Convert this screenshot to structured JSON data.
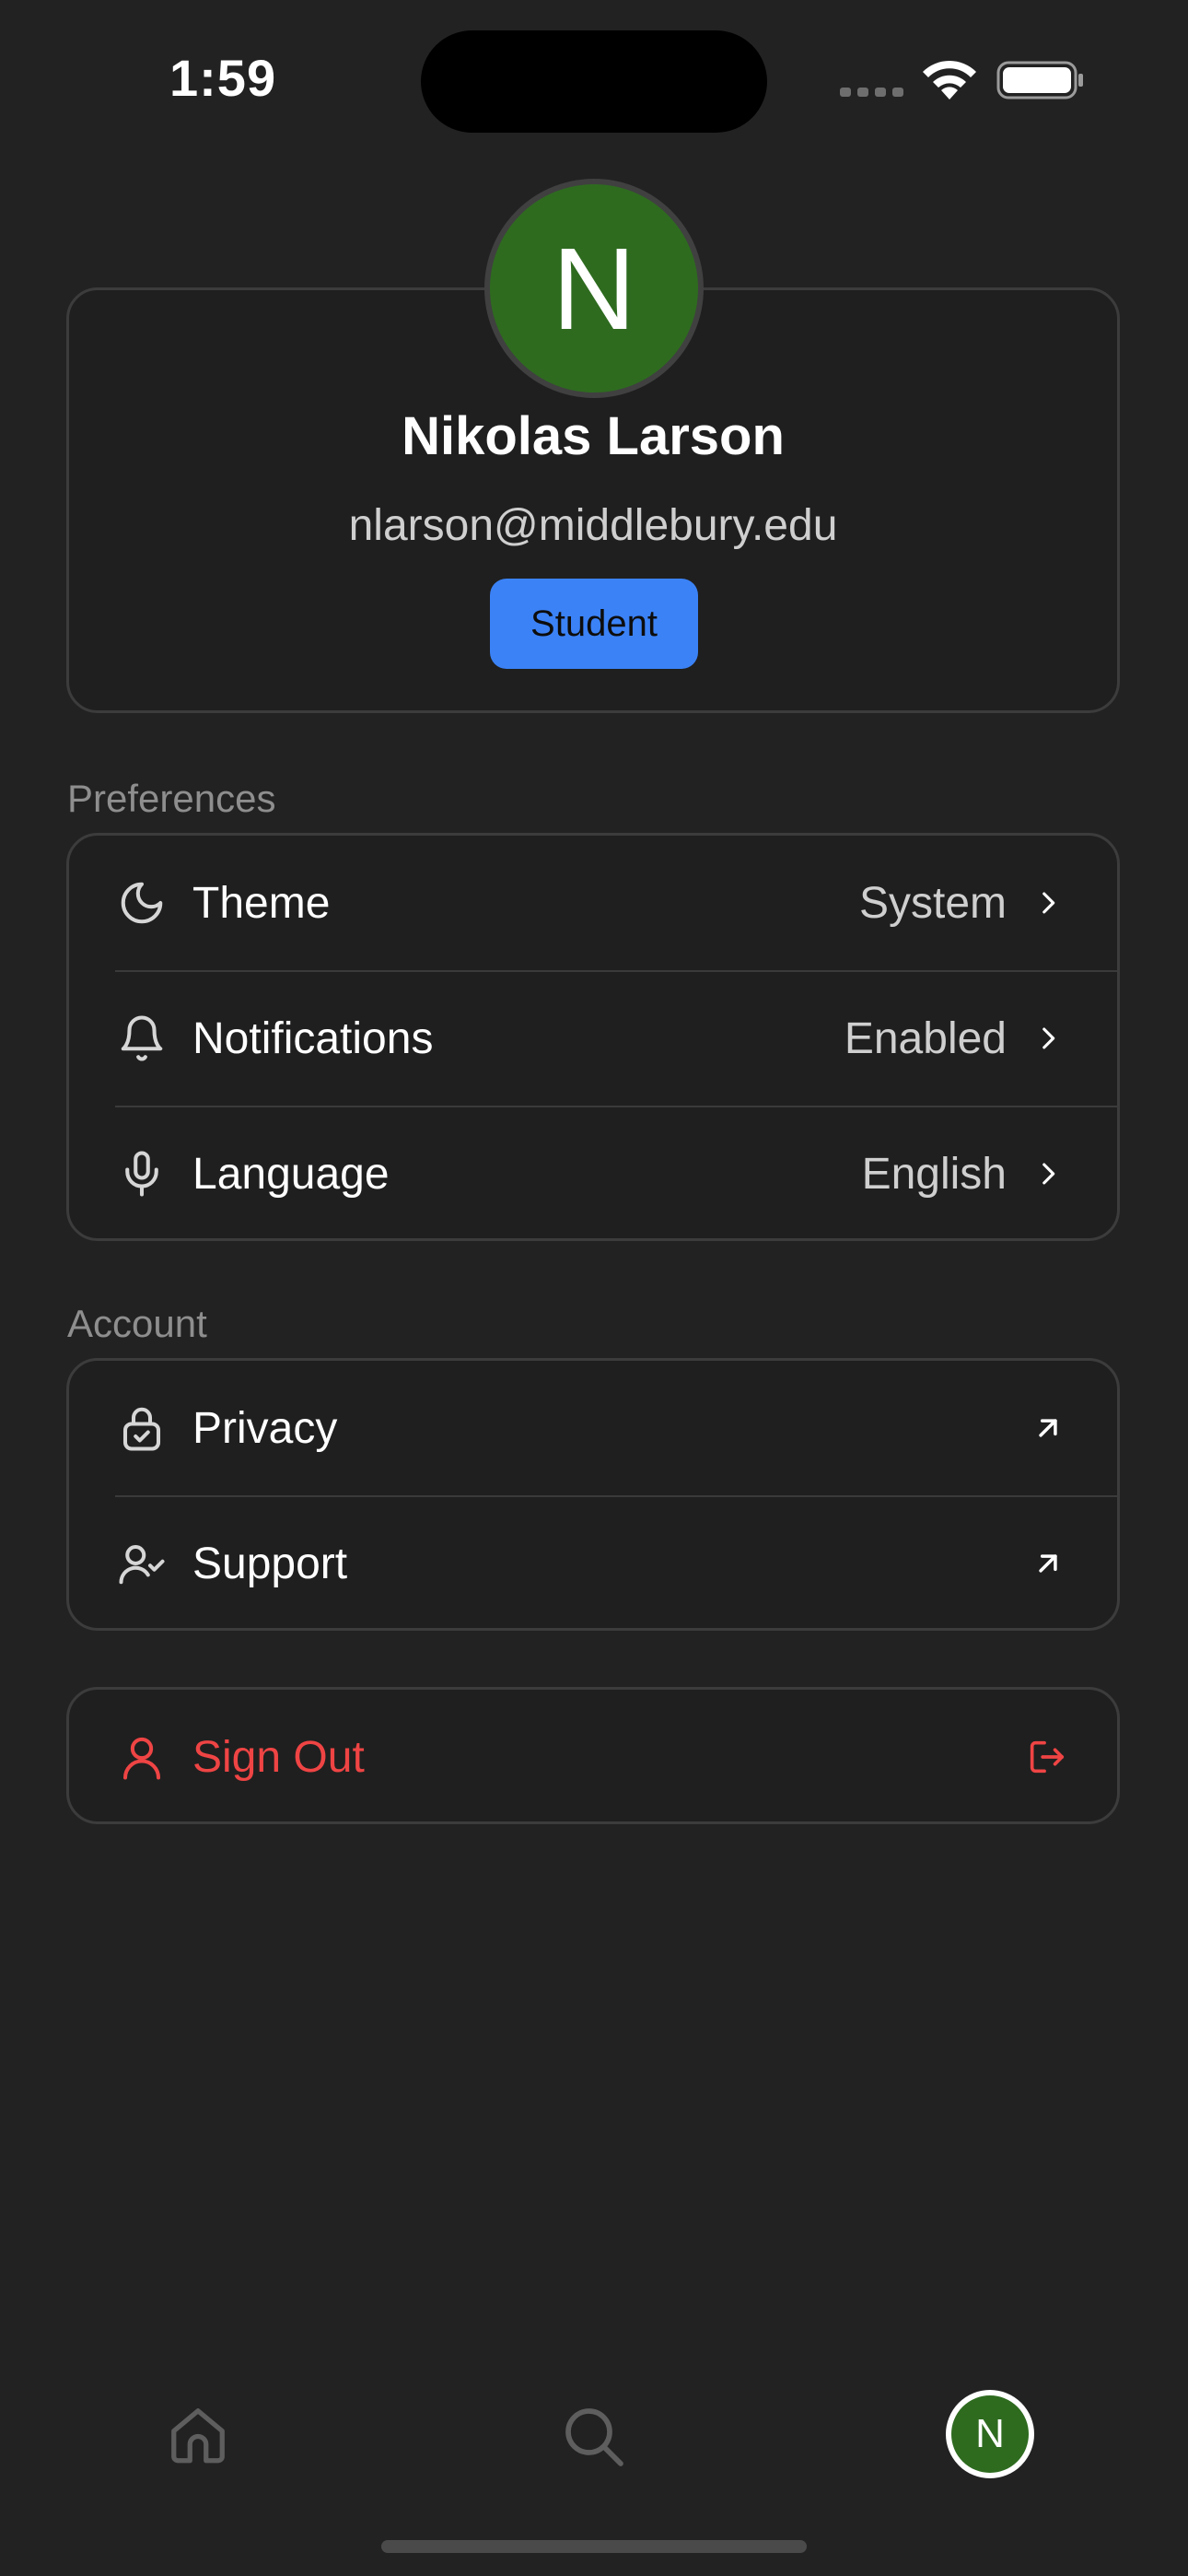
{
  "status_bar": {
    "time": "1:59",
    "icons": [
      "signal-icon",
      "wifi-icon",
      "battery-icon"
    ]
  },
  "profile": {
    "initial": "N",
    "name": "Nikolas Larson",
    "email": "nlarson@middlebury.edu",
    "role": "Student",
    "avatar_color": "#2e6b1f"
  },
  "preferences": {
    "section_label": "Preferences",
    "items": [
      {
        "label": "Theme",
        "value": "System",
        "icon": "moon-icon"
      },
      {
        "label": "Notifications",
        "value": "Enabled",
        "icon": "bell-icon"
      },
      {
        "label": "Language",
        "value": "English",
        "icon": "microphone-icon"
      }
    ]
  },
  "account": {
    "section_label": "Account",
    "items": [
      {
        "label": "Privacy",
        "icon": "lock-icon"
      },
      {
        "label": "Support",
        "icon": "user-check-icon"
      }
    ]
  },
  "sign_out": {
    "label": "Sign Out",
    "color": "#ef4444"
  },
  "tab_bar": {
    "items": [
      "home-icon",
      "search-icon",
      "profile-avatar"
    ],
    "avatar_initial": "N"
  },
  "colors": {
    "background": "#222222",
    "card": "#1f1f1f",
    "accent": "#3b82f6",
    "danger": "#ef4444"
  }
}
